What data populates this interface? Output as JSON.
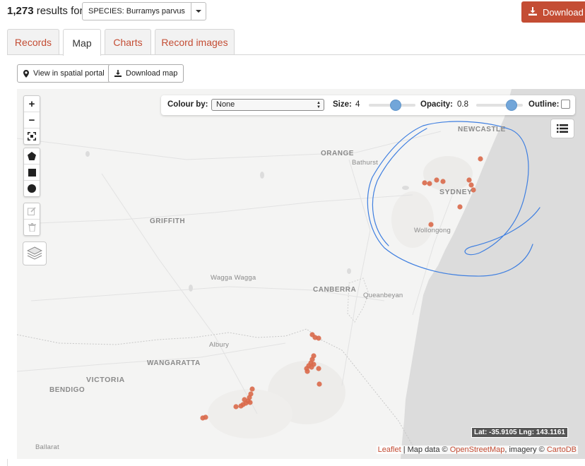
{
  "header": {
    "results_count": "1,273",
    "results_suffix": "results for",
    "facet_label": "SPECIES: Burramys parvus",
    "download_label": "Download"
  },
  "tabs": [
    {
      "label": "Records",
      "active": false
    },
    {
      "label": "Map",
      "active": true
    },
    {
      "label": "Charts",
      "active": false
    },
    {
      "label": "Record images",
      "active": false
    }
  ],
  "map_buttons": {
    "spatial_portal": "View in spatial portal",
    "download_map": "Download map"
  },
  "map_toolbar": {
    "colour_by_label": "Colour by:",
    "colour_by_value": "None",
    "size_label": "Size:",
    "size_value": "4",
    "opacity_label": "Opacity:",
    "opacity_value": "0.8",
    "outline_label": "Outline:"
  },
  "map_controls": {
    "zoom_in": "+",
    "zoom_out": "−"
  },
  "places": {
    "newcastle": "NEWCASTLE",
    "orange": "ORANGE",
    "bathurst": "Bathurst",
    "sydney": "SYDNEY",
    "griffith": "GRIFFITH",
    "wollongong": "Wollongong",
    "wagga": "Wagga Wagga",
    "canberra": "CANBERRA",
    "queanbeyan": "Queanbeyan",
    "albury": "Albury",
    "wangaratta": "WANGARATTA",
    "victoria": "VICTORIA",
    "bendigo": "BENDIGO",
    "ballarat": "Ballarat"
  },
  "coords_readout": "Lat: -35.9105 Lng: 143.1161",
  "attribution": {
    "leaflet": "Leaflet",
    "mid": " | Map data © ",
    "osm": "OpenStreetMap",
    "imagery": ", imagery © ",
    "carto": "CartoDB"
  },
  "colors": {
    "accent": "#c44d34",
    "record_dot": "#d9694a",
    "annotation": "#3f7fe0",
    "ocean": "#dcdcdc"
  }
}
